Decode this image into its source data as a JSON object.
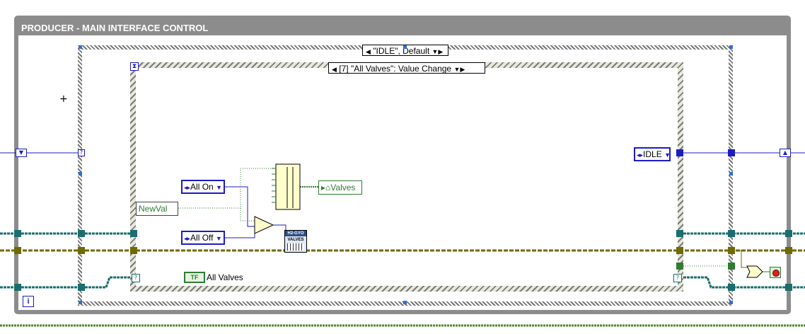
{
  "loop": {
    "title": "PRODUCER - MAIN INTERFACE CONTROL",
    "iteration_label": "i"
  },
  "case_structure": {
    "selector_label": "\"IDLE\", Default"
  },
  "event_structure": {
    "selector_label": "[7] \"All Valves\": Value Change"
  },
  "nodes": {
    "all_on": "All On",
    "all_off": "All Off",
    "new_val": "NewVal",
    "valves_indicator": "Valves",
    "idle_constant": "IDLE",
    "bool_terminal": {
      "tag": "TF",
      "label": "All Valves"
    },
    "subvi": {
      "line1": "H2-GYO",
      "line2": "VALVES"
    }
  },
  "colors": {
    "loop_frame": "#8c8c8c",
    "enum_wire": "#1c1cc4",
    "cluster_wire": "#1a6e6e",
    "error_wire": "#6f6b00",
    "boolean_wire": "#2e7d32",
    "stop_button": "#e02020"
  }
}
